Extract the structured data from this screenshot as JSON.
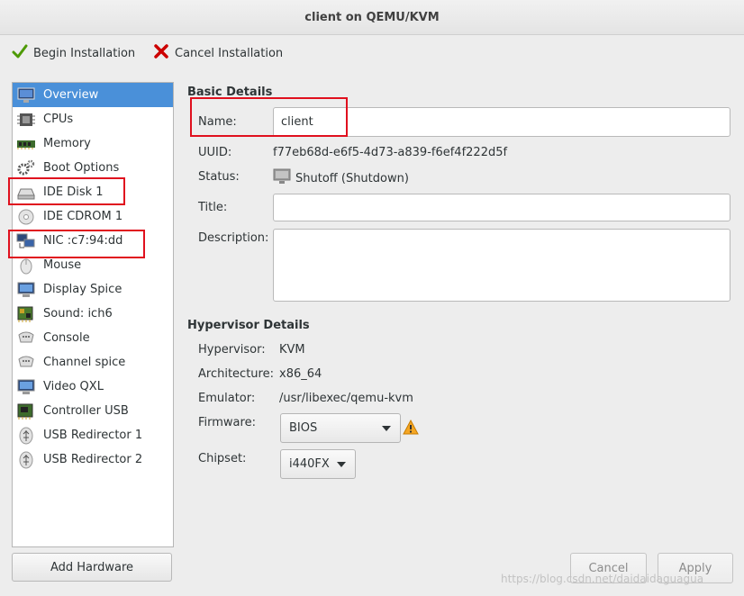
{
  "window": {
    "title": "client on QEMU/KVM"
  },
  "toolbar": {
    "begin_label": "Begin Installation",
    "cancel_label": "Cancel Installation"
  },
  "sidebar": {
    "items": [
      {
        "label": "Overview",
        "icon": "monitor-icon"
      },
      {
        "label": "CPUs",
        "icon": "cpu-icon"
      },
      {
        "label": "Memory",
        "icon": "memory-icon"
      },
      {
        "label": "Boot Options",
        "icon": "gears-icon"
      },
      {
        "label": "IDE Disk 1",
        "icon": "disk-icon"
      },
      {
        "label": "IDE CDROM 1",
        "icon": "cdrom-icon"
      },
      {
        "label": "NIC :c7:94:dd",
        "icon": "network-icon"
      },
      {
        "label": "Mouse",
        "icon": "mouse-icon"
      },
      {
        "label": "Display Spice",
        "icon": "display-icon"
      },
      {
        "label": "Sound: ich6",
        "icon": "sound-card-icon"
      },
      {
        "label": "Console",
        "icon": "serial-icon"
      },
      {
        "label": "Channel spice",
        "icon": "serial-icon"
      },
      {
        "label": "Video QXL",
        "icon": "display-icon"
      },
      {
        "label": "Controller USB",
        "icon": "controller-card-icon"
      },
      {
        "label": "USB Redirector 1",
        "icon": "usb-icon"
      },
      {
        "label": "USB Redirector 2",
        "icon": "usb-icon"
      }
    ],
    "selected_index": 0,
    "add_hardware_label": "Add Hardware"
  },
  "basic": {
    "section_title": "Basic Details",
    "name_label": "Name:",
    "name_value": "client",
    "uuid_label": "UUID:",
    "uuid_value": "f77eb68d-e6f5-4d73-a839-f6ef4f222d5f",
    "status_label": "Status:",
    "status_value": "Shutoff (Shutdown)",
    "title_label": "Title:",
    "title_value": "",
    "description_label": "Description:",
    "description_value": ""
  },
  "hypervisor": {
    "section_title": "Hypervisor Details",
    "hypervisor_label": "Hypervisor:",
    "hypervisor_value": "KVM",
    "architecture_label": "Architecture:",
    "architecture_value": "x86_64",
    "emulator_label": "Emulator:",
    "emulator_value": "/usr/libexec/qemu-kvm",
    "firmware_label": "Firmware:",
    "firmware_value": "BIOS",
    "chipset_label": "Chipset:",
    "chipset_value": "i440FX"
  },
  "buttons": {
    "cancel_label": "Cancel",
    "apply_label": "Apply"
  },
  "watermark": "https://blog.csdn.net/daidaidaguagua",
  "colors": {
    "selection": "#4a90d9",
    "highlight_box": "#e0101e",
    "warning": "#f5a623"
  }
}
